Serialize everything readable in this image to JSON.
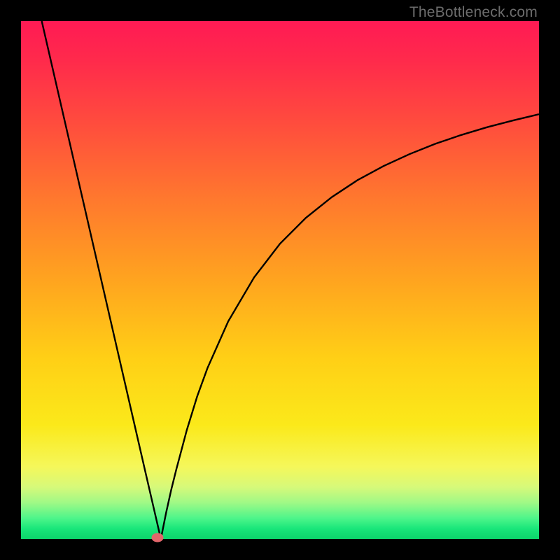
{
  "watermark": "TheBottleneck.com",
  "chart_data": {
    "type": "line",
    "title": "",
    "xlabel": "",
    "ylabel": "",
    "xlim": [
      0,
      100
    ],
    "ylim": [
      0,
      100
    ],
    "grid": false,
    "legend": false,
    "annotations": [],
    "series": [
      {
        "name": "left-branch",
        "x": [
          4.0,
          6.0,
          8.0,
          10.0,
          12.0,
          14.0,
          16.0,
          18.0,
          20.0,
          22.0,
          24.0,
          25.5,
          27.0
        ],
        "y": [
          100.0,
          91.3,
          82.6,
          73.9,
          65.2,
          56.5,
          47.8,
          39.1,
          30.4,
          21.7,
          13.0,
          6.5,
          0.0
        ]
      },
      {
        "name": "right-branch",
        "x": [
          27.0,
          28.0,
          29.0,
          30.0,
          32.0,
          34.0,
          36.0,
          40.0,
          45.0,
          50.0,
          55.0,
          60.0,
          65.0,
          70.0,
          75.0,
          80.0,
          85.0,
          90.0,
          95.0,
          100.0
        ],
        "y": [
          0.0,
          5.0,
          9.5,
          13.5,
          21.0,
          27.5,
          33.0,
          42.0,
          50.5,
          57.0,
          62.0,
          66.0,
          69.3,
          72.0,
          74.3,
          76.3,
          78.0,
          79.5,
          80.8,
          82.0
        ]
      }
    ],
    "marker": {
      "x_pct": 26.3,
      "y_pct": 0.3
    },
    "gradient_stops": [
      {
        "pct": 0,
        "color": "#ff1a54"
      },
      {
        "pct": 50,
        "color": "#ffa41f"
      },
      {
        "pct": 80,
        "color": "#f5f75a"
      },
      {
        "pct": 100,
        "color": "#0cd46a"
      }
    ]
  }
}
